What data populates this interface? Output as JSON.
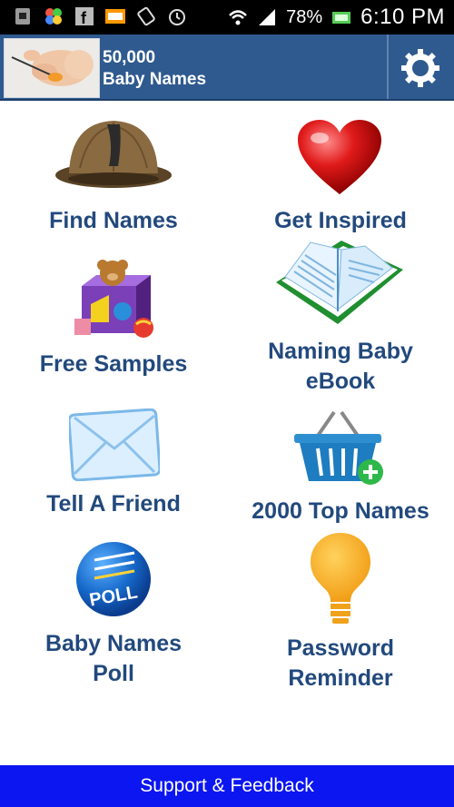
{
  "status_bar": {
    "battery": "78%",
    "time": "6:10 PM",
    "icons": [
      "sim-icon",
      "flower-icon",
      "facebook-icon",
      "notice-icon",
      "rotate-icon",
      "alarm-icon",
      "wifi-icon",
      "signal-icon",
      "battery-icon"
    ]
  },
  "header": {
    "title_line1": "50,000",
    "title_line2": "Baby Names",
    "settings_icon": "gear-icon"
  },
  "tiles": [
    {
      "label": [
        "Find Names"
      ],
      "icon": "detective-hat-icon"
    },
    {
      "label": [
        "Get Inspired"
      ],
      "icon": "heart-icon"
    },
    {
      "label": [
        "Free Samples"
      ],
      "icon": "toy-box-icon"
    },
    {
      "label": [
        "Naming Baby",
        "eBook"
      ],
      "icon": "open-book-icon"
    },
    {
      "label": [
        "Tell A Friend"
      ],
      "icon": "envelope-icon"
    },
    {
      "label": [
        "2000 Top Names"
      ],
      "icon": "basket-icon"
    },
    {
      "label": [
        "Baby Names",
        "Poll"
      ],
      "icon": "poll-icon"
    },
    {
      "label": [
        "Password",
        "Reminder"
      ],
      "icon": "lightbulb-icon"
    }
  ],
  "footer": {
    "label": "Support & Feedback"
  },
  "colors": {
    "header_bg": "#2f5a8f",
    "label_text": "#22497d",
    "footer_bg": "#0b16f0"
  }
}
